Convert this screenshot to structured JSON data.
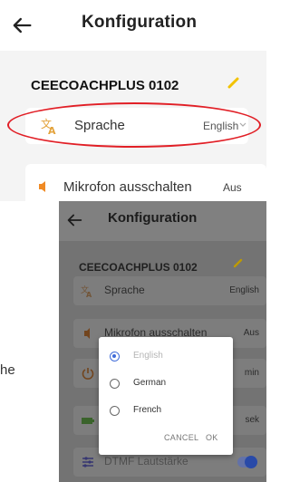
{
  "screen1": {
    "title": "Konfiguration",
    "device_name": "CEECOACHPLUS 0102",
    "rows": [
      {
        "label": "Sprache",
        "value": "English",
        "icon": "translate-icon"
      },
      {
        "label": "Mikrofon ausschalten",
        "value": "Aus",
        "icon": "speaker-icon"
      }
    ],
    "colors": {
      "accent": "#f2c200",
      "highlight_ring": "#e11f26",
      "speaker": "#f08a24"
    }
  },
  "screen2": {
    "title": "Konfiguration",
    "device_name": "CEECOACHPLUS 0102",
    "rows": [
      {
        "label": "Sprache",
        "value": "English"
      },
      {
        "label": "Mikrofon ausschalten",
        "value": "Aus"
      },
      {
        "label": "",
        "value": "min"
      },
      {
        "label": "",
        "value": "sek"
      },
      {
        "label": "DTMF Lautstärke",
        "value": ""
      }
    ],
    "dialog": {
      "options": [
        {
          "label": "English",
          "selected": true
        },
        {
          "label": "German",
          "selected": false
        },
        {
          "label": "French",
          "selected": false
        }
      ],
      "cancel_label": "CANCEL",
      "ok_label": "OK"
    },
    "colors": {
      "radio_selected": "#3f6bd8",
      "toggle": "#2c4fb3"
    }
  },
  "stray_text": "he"
}
